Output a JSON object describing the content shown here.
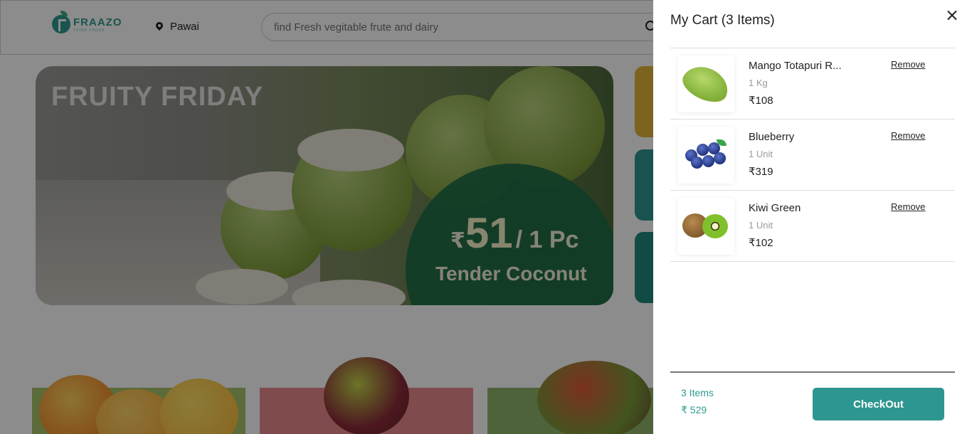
{
  "header": {
    "logo_name": "FRAAZO",
    "logo_tagline": "THINK FRESH",
    "location": "Pawai",
    "search_placeholder": "find Fresh vegitable frute and dairy"
  },
  "banner": {
    "title": "FRUITY FRIDAY",
    "currency": "₹",
    "price": "51",
    "unit": "/ 1 Pc",
    "product": "Tender Coconut"
  },
  "cart": {
    "title": "My Cart (3 Items)",
    "items": [
      {
        "name": "Mango Totapuri R...",
        "qty": "1 Kg",
        "price": "₹108",
        "remove_label": "Remove",
        "icon": "mango-icon"
      },
      {
        "name": "Blueberry",
        "qty": "1 Unit",
        "price": "₹319",
        "remove_label": "Remove",
        "icon": "blueberry-icon"
      },
      {
        "name": "Kiwi Green",
        "qty": "1 Unit",
        "price": "₹102",
        "remove_label": "Remove",
        "icon": "kiwi-icon"
      }
    ],
    "summary": {
      "count": "3 Items",
      "total": "₹ 529"
    },
    "checkout_label": "CheckOut"
  },
  "colors": {
    "accent": "#2e9690",
    "banner_circle": "#1e6e46"
  }
}
